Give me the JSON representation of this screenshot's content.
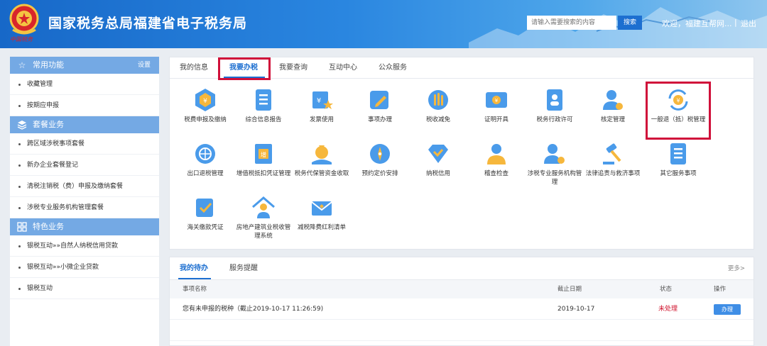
{
  "header": {
    "site_title": "国家税务总局福建省电子税务局",
    "emblem_text": "中国税务",
    "search_placeholder": "请输入需要搜索的内容",
    "search_button": "搜索",
    "welcome": "欢迎，福建互帮网...",
    "separator": "|",
    "logout": "退出",
    "colors": {
      "header_start": "#1768c8",
      "header_end": "#8fc6ee"
    }
  },
  "sidebar": {
    "sections": [
      {
        "title": "常用功能",
        "icon": "star-icon",
        "setting": "设置",
        "items": [
          "收藏管理",
          "按期应申报"
        ]
      },
      {
        "title": "套餐业务",
        "icon": "layers-icon",
        "items": [
          "跨区域涉税事项套餐",
          "新办企业套餐登记",
          "清税注销税（费）申报及缴纳套餐",
          "涉税专业服务机构管理套餐"
        ]
      },
      {
        "title": "特色业务",
        "icon": "grid-icon",
        "items": [
          "银税互动»»自然人纳税信用贷款",
          "银税互动»»小微企业贷款",
          "银税互动"
        ]
      }
    ]
  },
  "main": {
    "tabs": [
      "我的信息",
      "我要办税",
      "我要查询",
      "互动中心",
      "公众服务"
    ],
    "active_tab": "我要办税",
    "services": [
      {
        "label": "税费申报及缴纳",
        "icon": "tax-declare-icon"
      },
      {
        "label": "综合信息报告",
        "icon": "report-icon"
      },
      {
        "label": "发票使用",
        "icon": "invoice-icon"
      },
      {
        "label": "事项办理",
        "icon": "edit-icon"
      },
      {
        "label": "税收减免",
        "icon": "coins-icon"
      },
      {
        "label": "证明开具",
        "icon": "certificate-icon"
      },
      {
        "label": "税务行政许可",
        "icon": "permit-icon"
      },
      {
        "label": "核定管理",
        "icon": "user-gear-icon"
      },
      {
        "label": "一般退（抵）税管理",
        "icon": "refund-icon"
      },
      {
        "label": "出口退税管理",
        "icon": "export-icon"
      },
      {
        "label": "增值税抵扣凭证管理",
        "icon": "vat-icon"
      },
      {
        "label": "税务代保管资金收取",
        "icon": "money-bag-icon"
      },
      {
        "label": "预约定价安排",
        "icon": "compass-icon"
      },
      {
        "label": "纳税信用",
        "icon": "diamond-icon"
      },
      {
        "label": "稽查检查",
        "icon": "inspector-icon"
      },
      {
        "label": "涉税专业服务机构管理",
        "icon": "agency-icon"
      },
      {
        "label": "法律追责与救济事项",
        "icon": "gavel-icon"
      },
      {
        "label": "其它服务事项",
        "icon": "list-icon"
      },
      {
        "label": "海关缴款凭证",
        "icon": "customs-icon"
      },
      {
        "label": "房地产建筑业税收管理系统",
        "icon": "house-icon"
      },
      {
        "label": "减税降费红利清单",
        "icon": "mail-icon"
      }
    ]
  },
  "todo": {
    "tabs": [
      "我的待办",
      "服务提醒"
    ],
    "more": "更多>",
    "columns": [
      "事项名称",
      "截止日期",
      "状态",
      "操作"
    ],
    "rows": [
      {
        "name": "您有未申报的税种（截止2019-10-17 11:26:59)",
        "deadline": "2019-10-17",
        "status": "未处理",
        "action": "办理"
      }
    ]
  }
}
